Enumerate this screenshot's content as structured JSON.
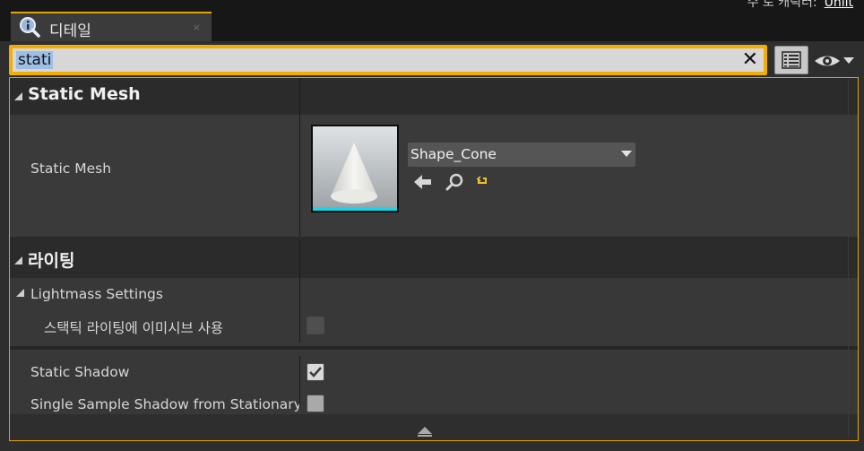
{
  "top_right_text": "수 로 캐릭터:",
  "top_right_link": "Unlit",
  "tab": {
    "title": "디테일",
    "close_glyph": "×"
  },
  "search": {
    "value": "stati",
    "clear_glyph": "✕"
  },
  "toolbar": {
    "view_options_icon": "grid-list-icon",
    "visibility_icon": "eye-icon"
  },
  "categories": [
    {
      "title": "Static Mesh",
      "properties": [
        {
          "label": "Static Mesh",
          "asset_name": "Shape_Cone",
          "actions": [
            "use-selected-arrow-icon",
            "browse-magnifier-icon",
            "reset-to-default-icon"
          ]
        }
      ]
    },
    {
      "title": "라이팅",
      "subcategory": "Lightmass Settings",
      "properties": [
        {
          "label": "스택틱 라이팅에 이미시브 사용",
          "checked": false,
          "enabled": false
        },
        {
          "label": "Static Shadow",
          "checked": true,
          "enabled": true
        },
        {
          "label": "Single Sample Shadow from Stationary Lights",
          "checked": false,
          "enabled": true
        }
      ]
    }
  ],
  "colors": {
    "accent": "#e8a100",
    "selection": "#9dbfe6",
    "thumbnail_bar": "#16d6e8"
  }
}
